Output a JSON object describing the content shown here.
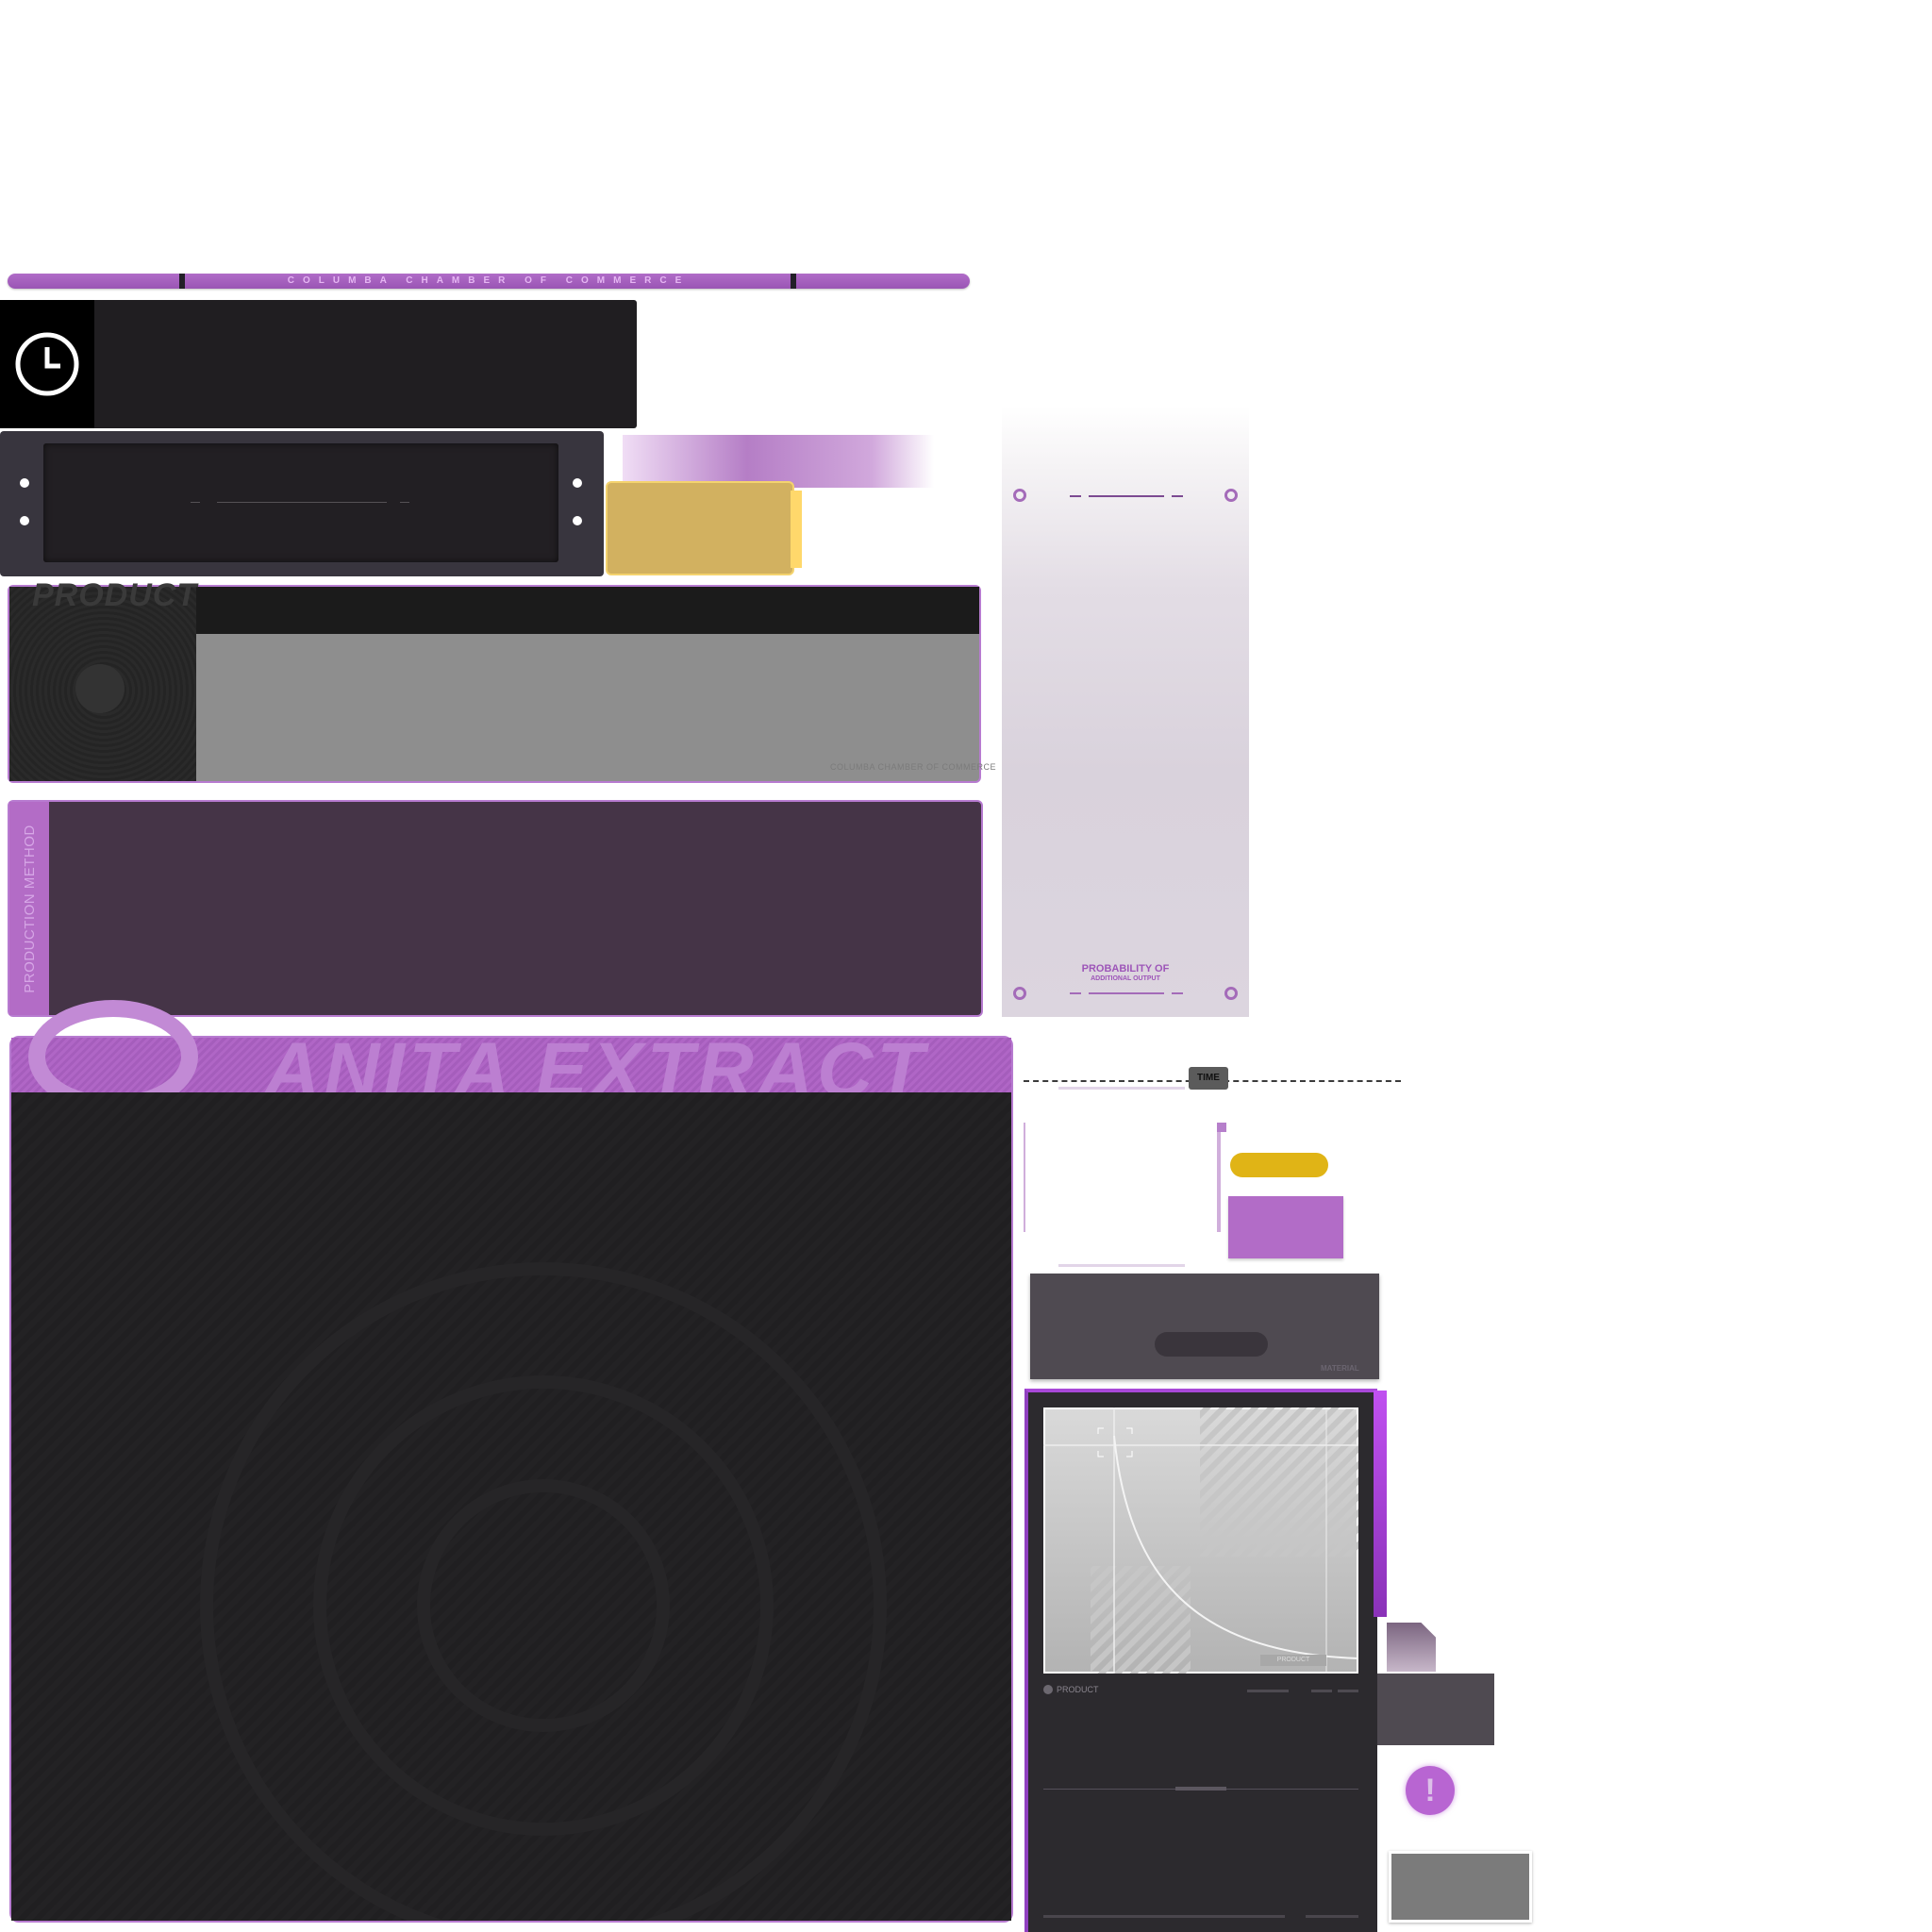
{
  "banner": {
    "title": "COLUMBA CHAMBER OF COMMERCE"
  },
  "clock": {
    "icon": "clock-icon"
  },
  "product_card": {
    "title": "PRODUCT",
    "footer": "COLUMBA CHAMBER OF COMMERCE"
  },
  "production_method": {
    "label": "PRODUCTION METHOD"
  },
  "probability": {
    "title": "PROBABILITY OF",
    "subtitle": "ADDITIONAL OUTPUT"
  },
  "extraction": {
    "title": "ANITA EXTRACT"
  },
  "timeline": {
    "label": "TIME"
  },
  "material": {
    "label": "MATERIAL"
  },
  "chart_card": {
    "product_label": "PRODUCT",
    "tag": "PRODUCT"
  },
  "alert": {
    "symbol": "!"
  },
  "colors": {
    "accent_purple": "#b36cc6",
    "gold": "#d2b160",
    "yellow": "#e0b416",
    "dark_panel": "#201e21",
    "method_panel": "#453447"
  }
}
